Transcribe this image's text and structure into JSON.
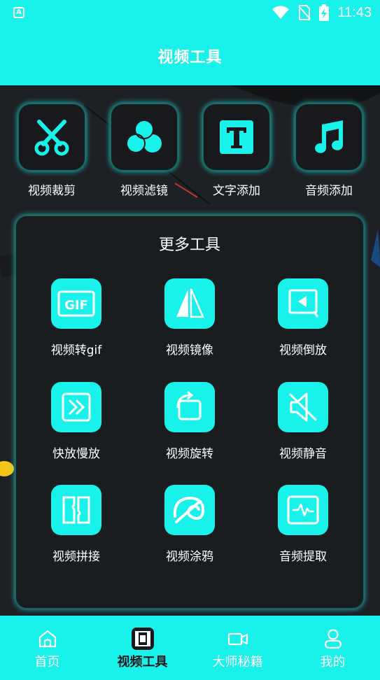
{
  "statusbar": {
    "badge": "A",
    "time": "11:43"
  },
  "header": {
    "title": "视频工具"
  },
  "top_tools": [
    {
      "label": "视频裁剪",
      "icon": "scissors-icon"
    },
    {
      "label": "视频滤镜",
      "icon": "filter-circles-icon"
    },
    {
      "label": "文字添加",
      "icon": "text-t-icon"
    },
    {
      "label": "音频添加",
      "icon": "music-note-icon"
    }
  ],
  "more_tools": {
    "title": "更多工具",
    "items": [
      {
        "label": "视频转gif",
        "icon": "gif-icon"
      },
      {
        "label": "视频镜像",
        "icon": "mirror-icon"
      },
      {
        "label": "视频倒放",
        "icon": "reverse-icon"
      },
      {
        "label": "快放慢放",
        "icon": "fast-forward-icon"
      },
      {
        "label": "视频旋转",
        "icon": "rotate-icon"
      },
      {
        "label": "视频静音",
        "icon": "mute-icon"
      },
      {
        "label": "视频拼接",
        "icon": "splice-icon"
      },
      {
        "label": "视频涂鸦",
        "icon": "doodle-icon"
      },
      {
        "label": "音频提取",
        "icon": "audio-extract-icon"
      }
    ],
    "gif_icon_text": "GIF"
  },
  "nav": [
    {
      "label": "首页",
      "icon": "home-icon",
      "active": false
    },
    {
      "label": "视频工具",
      "icon": "film-icon",
      "active": true
    },
    {
      "label": "大师秘籍",
      "icon": "video-camera-icon",
      "active": false
    },
    {
      "label": "我的",
      "icon": "user-icon",
      "active": false
    }
  ],
  "colors": {
    "accent": "#19f1eb",
    "background": "#1d2024",
    "tile": "#17191c"
  }
}
